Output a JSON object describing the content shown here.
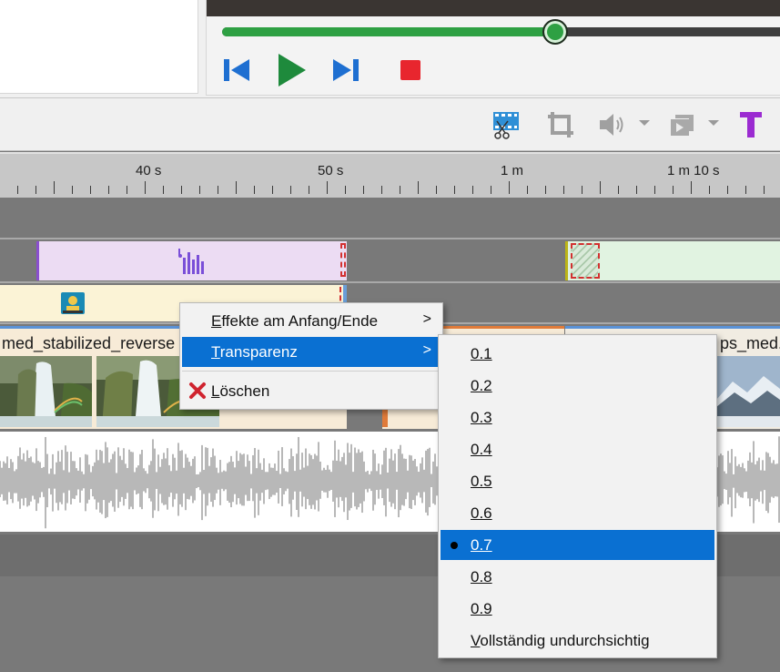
{
  "player": {
    "seek_fraction": 0.59,
    "controls": [
      "rewind",
      "play",
      "forward",
      "stop"
    ]
  },
  "toolbar": {
    "buttons": [
      "video-cut",
      "crop",
      "volume",
      "effects",
      "text"
    ]
  },
  "ruler": {
    "labels": [
      "40 s",
      "50 s",
      "1 m",
      "1 m 10 s"
    ]
  },
  "clips": {
    "video_clip_1": {
      "name": "med_stabilized_reverse"
    },
    "video_clip_2": {
      "name": "ps_med.m"
    }
  },
  "context_menu": {
    "items": [
      {
        "label": "Effekte am Anfang/Ende",
        "mnemonic": "E",
        "rest": "ffekte am Anfang/Ende",
        "has_submenu": true
      },
      {
        "label": "Transparenz",
        "mnemonic": "T",
        "rest": "ransparenz",
        "has_submenu": true,
        "highlighted": true
      },
      {
        "label": "Löschen",
        "mnemonic": "L",
        "rest": "öschen",
        "icon": "delete-x-icon"
      }
    ],
    "arrow": ">"
  },
  "transparency_submenu": {
    "items": [
      {
        "label": "0.1"
      },
      {
        "label": "0.2"
      },
      {
        "label": "0.3"
      },
      {
        "label": "0.4"
      },
      {
        "label": "0.5"
      },
      {
        "label": "0.6"
      },
      {
        "label": "0.7",
        "selected": true
      },
      {
        "label": "0.8"
      },
      {
        "label": "0.9"
      },
      {
        "label": "Vollständig undurchsichtig"
      }
    ]
  },
  "colors": {
    "accent_blue": "#0a70d2",
    "seek_green": "#2ea043",
    "text_icon_purple": "#9b2bd1",
    "delete_red": "#d0242f"
  }
}
